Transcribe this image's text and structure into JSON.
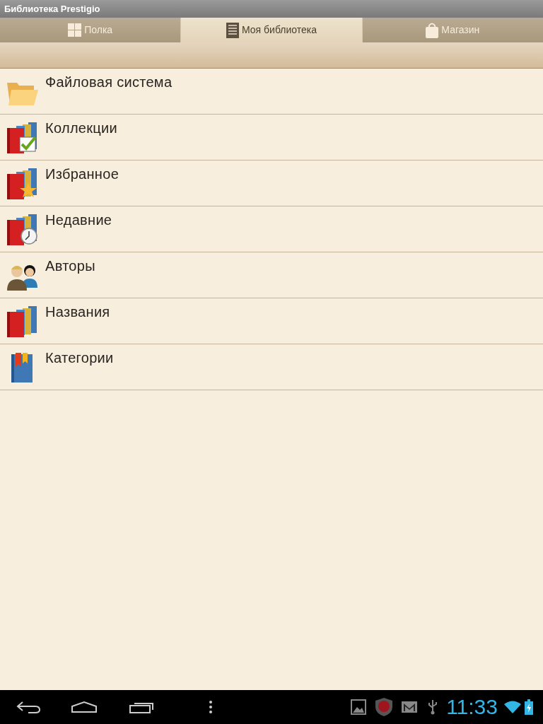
{
  "title_bar": {
    "title": "Библиотека Prestigio"
  },
  "tabs": [
    {
      "label": "Полка",
      "kind": "grid",
      "selected": false
    },
    {
      "label": "Моя библиотека",
      "kind": "list",
      "selected": true
    },
    {
      "label": "Магазин",
      "kind": "bag",
      "selected": false
    }
  ],
  "items": [
    {
      "label": "Файловая система",
      "kind": "folder"
    },
    {
      "label": "Коллекции",
      "kind": "collections"
    },
    {
      "label": "Избранное",
      "kind": "favorites"
    },
    {
      "label": "Недавние",
      "kind": "recent"
    },
    {
      "label": "Авторы",
      "kind": "authors"
    },
    {
      "label": "Названия",
      "kind": "titles"
    },
    {
      "label": "Категории",
      "kind": "categories"
    }
  ],
  "status_bar": {
    "time": "11:33"
  }
}
